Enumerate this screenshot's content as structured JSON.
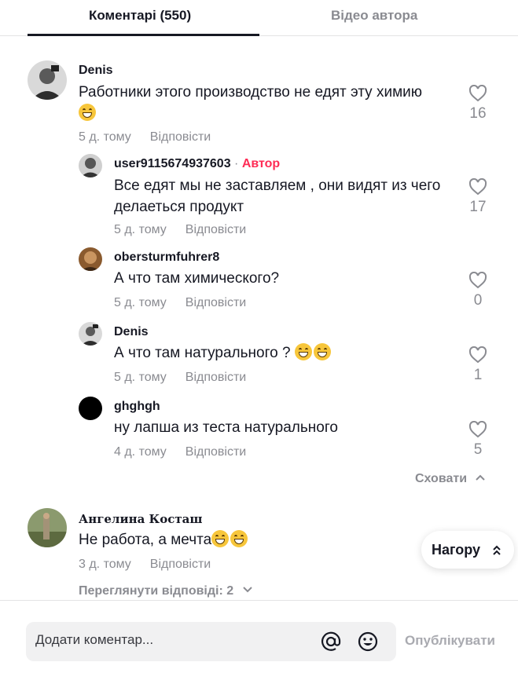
{
  "tabs": {
    "comments": "Коментарі (550)",
    "videos": "Відео автора"
  },
  "comments": [
    {
      "username": "Denis",
      "text": "Работники этого производство не едят эту химию",
      "emoji": [
        "grin"
      ],
      "time": "5 д. тому",
      "reply": "Відповісти",
      "likes": "16",
      "avatar_color": "#3a3a3a",
      "replies": [
        {
          "username": "user9115674937603",
          "author_sep": " · ",
          "author_badge": "Автор",
          "text": "Все едят мы не заставляем , они видят из чего делаеться продукт",
          "time": "5 д. тому",
          "reply": "Відповісти",
          "likes": "17",
          "avatar_color": "#4b4b4b"
        },
        {
          "username": "obersturmfuhrer8",
          "text": "А что там химического?",
          "time": "5 д. тому",
          "reply": "Відповісти",
          "likes": "0",
          "avatar_color": "#6b4a2a"
        },
        {
          "username": "Denis",
          "text": "А что там натурального ?",
          "emoji": [
            "joy",
            "joy"
          ],
          "time": "5 д. тому",
          "reply": "Відповісти",
          "likes": "1",
          "avatar_color": "#3a3a3a"
        },
        {
          "username": "ghghgh",
          "text": "ну лапша из теста натурального",
          "time": "4 д. тому",
          "reply": "Відповісти",
          "likes": "5",
          "avatar_color": "#000000"
        }
      ],
      "hide_label": "Сховати"
    },
    {
      "username": "Ангелина Косташ",
      "text": "Не работа, а мечта",
      "emoji": [
        "joy",
        "joy"
      ],
      "time": "3 д. тому",
      "reply": "Відповісти",
      "avatar_color": "#6d7a55",
      "view_replies": "Переглянути відповіді: 2"
    }
  ],
  "top_button": "Нагору",
  "footer": {
    "placeholder": "Додати коментар...",
    "post": "Опублікувати"
  },
  "colors": {
    "accent": "#fe2c55",
    "muted": "#8a8b91",
    "text": "#161823"
  }
}
